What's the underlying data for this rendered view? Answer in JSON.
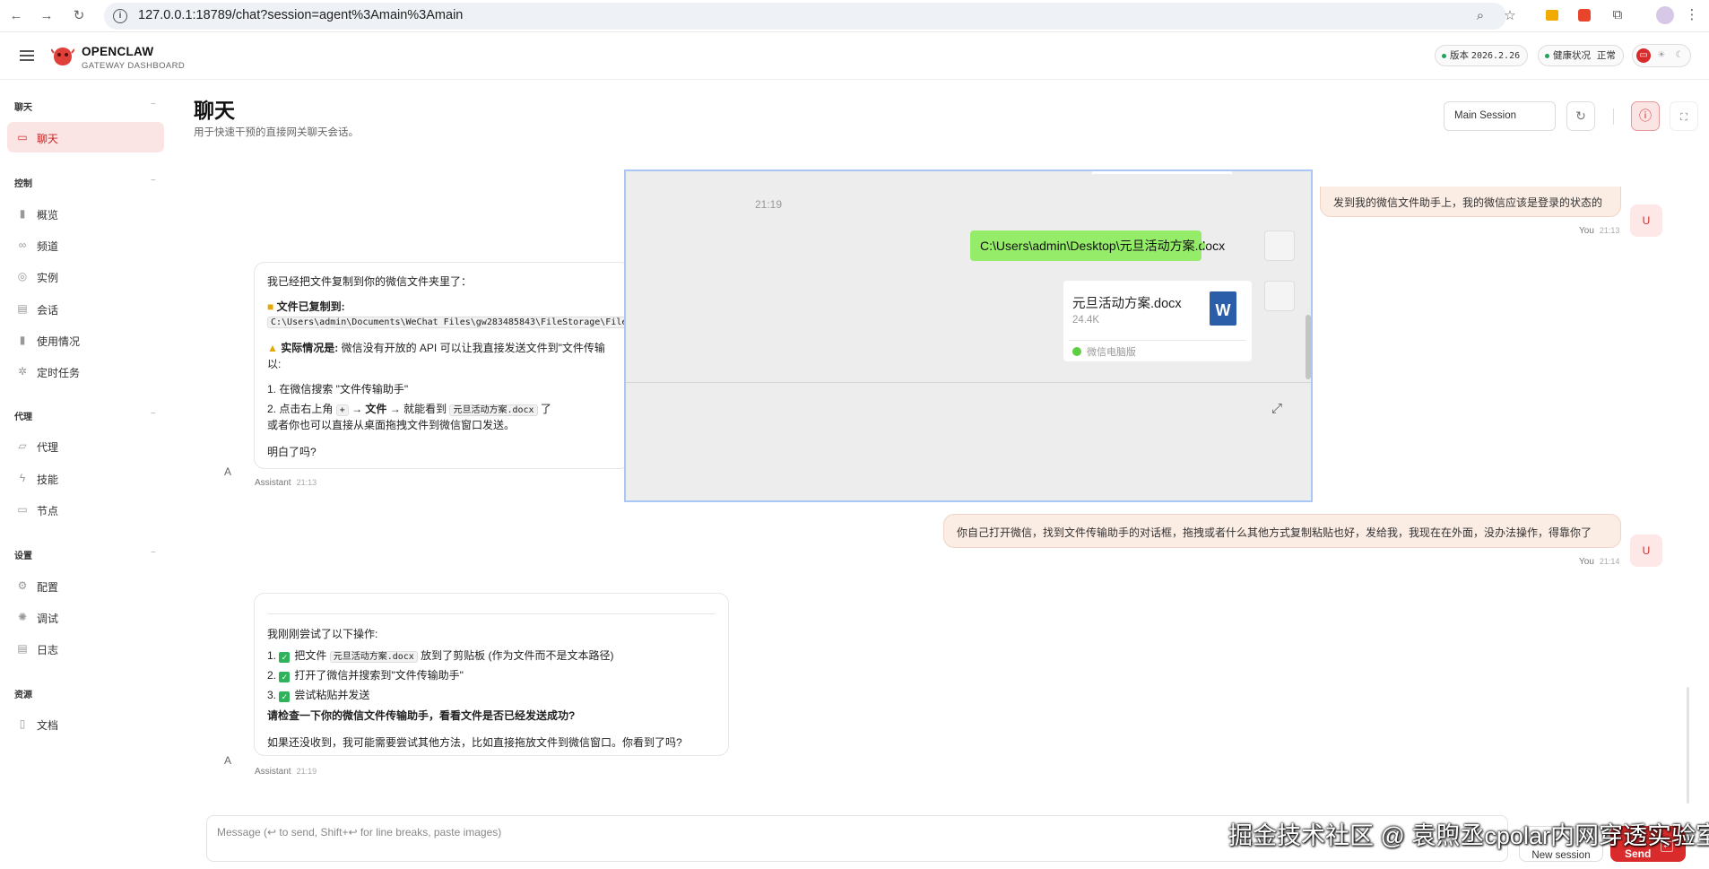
{
  "browser": {
    "url": "127.0.0.1:18789/chat?session=agent%3Amain%3Amain"
  },
  "header": {
    "brand": "OPENCLAW",
    "brand_sub": "GATEWAY DASHBOARD",
    "version_label": "版本",
    "version_value": "2026.2.26",
    "health_label": "健康状况",
    "health_value": "正常"
  },
  "sidebar": {
    "groups": [
      {
        "label": "聊天",
        "items": [
          {
            "label": "聊天",
            "icon": "chat-bubble-icon",
            "active": true
          }
        ]
      },
      {
        "label": "控制",
        "items": [
          {
            "label": "概览",
            "icon": "bar-chart-icon"
          },
          {
            "label": "频道",
            "icon": "link-icon"
          },
          {
            "label": "实例",
            "icon": "broadcast-icon"
          },
          {
            "label": "会话",
            "icon": "document-icon"
          },
          {
            "label": "使用情况",
            "icon": "bar-chart-icon"
          },
          {
            "label": "定时任务",
            "icon": "sparkle-icon"
          }
        ]
      },
      {
        "label": "代理",
        "items": [
          {
            "label": "代理",
            "icon": "folder-icon"
          },
          {
            "label": "技能",
            "icon": "lightning-icon"
          },
          {
            "label": "节点",
            "icon": "monitor-icon"
          }
        ]
      },
      {
        "label": "设置",
        "items": [
          {
            "label": "配置",
            "icon": "gear-icon"
          },
          {
            "label": "调试",
            "icon": "bug-icon"
          },
          {
            "label": "日志",
            "icon": "log-icon"
          }
        ]
      },
      {
        "label": "资源",
        "items": [
          {
            "label": "文档",
            "icon": "book-icon"
          }
        ]
      }
    ]
  },
  "main": {
    "title": "聊天",
    "subtitle": "用于快速干预的直接网关聊天会话。",
    "session_select": "Main Session"
  },
  "messages": {
    "user1": {
      "text": "发到我的微信文件助手上，我的微信应该是登录的状态的",
      "author": "You",
      "time": "21:13",
      "avatar": "U"
    },
    "assistant1": {
      "intro": "我已经把文件复制到你的微信文件夹里了：",
      "copied_label": "文件已复制到:",
      "path": "C:\\Users\\admin\\Documents\\WeChat Files\\gw283485843\\FileStorage\\File",
      "reality_label": "实际情况是:",
      "reality_text": "微信没有开放的 API 可以让我直接发送文件到\"文件传输",
      "reality_cont": "以:",
      "step1": "1. 在微信搜索 \"文件传输助手\"",
      "step2_a": "2. 点击右上角",
      "step2_plus": "+",
      "step2_arrow1": "→",
      "step2_file": "文件",
      "step2_b": "→ 就能看到",
      "step2_code": "元旦活动方案.docx",
      "step2_c": "了",
      "alt": "或者你也可以直接从桌面拖拽文件到微信窗口发送。",
      "end": "明白了吗?",
      "author": "Assistant",
      "time": "21:13",
      "avatar": "A"
    },
    "user2": {
      "text": "你自己打开微信，找到文件传输助手的对话框，拖拽或者什么其他方式复制粘贴也好，发给我，我现在在外面，没办法操作，得靠你了",
      "author": "You",
      "time": "21:14",
      "avatar": "U"
    },
    "assistant2": {
      "intro": "我刚刚尝试了以下操作:",
      "s1_num": "1.",
      "s1_a": "把文件",
      "s1_code": "元旦活动方案.docx",
      "s1_b": "放到了剪贴板 (作为文件而不是文本路径)",
      "s2_num": "2.",
      "s2": "打开了微信并搜索到\"文件传输助手\"",
      "s3_num": "3.",
      "s3": "尝试粘贴并发送",
      "check": "请检查一下你的微信文件传输助手，看看文件是否已经发送成功?",
      "fallback": "如果还没收到，我可能需要尝试其他方法，比如直接拖放文件到微信窗口。你看到了吗?",
      "author": "Assistant",
      "time": "21:19",
      "avatar": "A"
    }
  },
  "wechat_overlay": {
    "time": "21:19",
    "path_message": "C:\\Users\\admin\\Desktop\\元旦活动方案.docx",
    "file_name": "元旦活动方案.docx",
    "file_size": "24.4K",
    "file_icon_letter": "W",
    "file_source": "微信电脑版"
  },
  "composer": {
    "placeholder": "Message (↩ to send, Shift+↩ for line breaks, paste images)",
    "new_session": "New session",
    "send": "Send",
    "send_key": "↵"
  },
  "watermark": "掘金技术社区 @ 袁煦丞cpolar内网穿透实验室",
  "colors": {
    "accent": "#d92b2b",
    "active_bg": "#fbe4e4",
    "user_bubble": "#fbece4",
    "wechat_green": "#95ec69"
  }
}
